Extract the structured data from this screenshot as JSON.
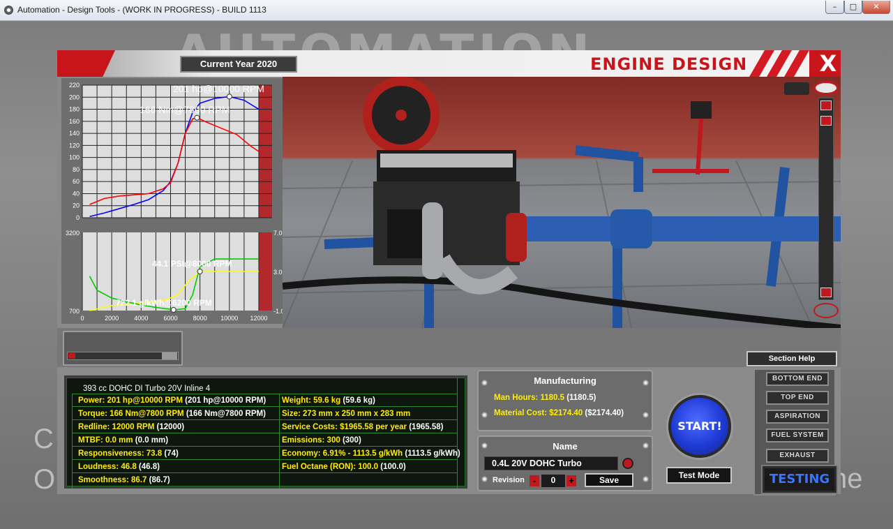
{
  "window": {
    "title": "Automation - Design Tools - (WORK IN PROGRESS) - BUILD 1113",
    "minimize": "–",
    "maximize": "□",
    "close": "✕"
  },
  "background": {
    "logo": "AUTOMATION",
    "left_text_1": "C",
    "left_text_2": "O",
    "right_text": "ne"
  },
  "header": {
    "current_year": "Current Year 2020",
    "title": "ENGINE DESIGN",
    "close": "X"
  },
  "chart_data": [
    {
      "type": "line",
      "title": "",
      "xlim": [
        0,
        12000
      ],
      "ylim": [
        0,
        220
      ],
      "yticks": [
        0,
        20,
        40,
        60,
        80,
        100,
        120,
        140,
        160,
        180,
        200,
        220
      ],
      "redline": 12000,
      "series": [
        {
          "color": "#0000ff",
          "x": [
            500,
            1500,
            2500,
            3500,
            4500,
            5500,
            6000,
            6500,
            7000,
            7500,
            8000,
            9000,
            10000,
            11000,
            12000
          ],
          "values": [
            2,
            8,
            15,
            22,
            30,
            45,
            60,
            90,
            140,
            175,
            190,
            198,
            201,
            195,
            180
          ]
        },
        {
          "color": "#ff0000",
          "x": [
            500,
            1500,
            2500,
            3500,
            4500,
            5500,
            6000,
            6500,
            7000,
            7500,
            7800,
            8500,
            9500,
            10500,
            11500,
            12000
          ],
          "values": [
            22,
            32,
            36,
            38,
            40,
            48,
            58,
            90,
            140,
            164,
            166,
            158,
            148,
            138,
            118,
            110
          ]
        }
      ],
      "annotations": [
        {
          "text": "201 hp@10000 RPM",
          "x": 10000,
          "y": 201
        },
        {
          "text": "166 Nm@7800 RPM",
          "x": 7800,
          "y": 166
        }
      ]
    },
    {
      "type": "line",
      "xlim": [
        0,
        12000
      ],
      "x_ticks": [
        0,
        2000,
        4000,
        6000,
        8000,
        10000,
        12000
      ],
      "left_ylim": [
        700,
        3200
      ],
      "left_ticks": [
        700,
        3200
      ],
      "right_ylim": [
        -1.0,
        7.0
      ],
      "right_ticks": [
        "7.0",
        "3.0",
        "-1.0"
      ],
      "redline": 12000,
      "series": [
        {
          "color": "#ffff00",
          "axis": "right",
          "x": [
            500,
            2000,
            4000,
            5500,
            6500,
            7200,
            8000,
            9000,
            12000
          ],
          "values": [
            -1.0,
            -0.5,
            -0.2,
            0.0,
            0.6,
            2.0,
            3.0,
            3.0,
            3.0
          ]
        },
        {
          "color": "#00cc00",
          "axis": "left",
          "x": [
            500,
            1000,
            2000,
            3000,
            4000,
            5000,
            6000,
            6200,
            7000,
            7500,
            8000,
            9000,
            10000,
            12000
          ],
          "values": [
            1800,
            1350,
            1100,
            980,
            880,
            800,
            740,
            722,
            760,
            1200,
            2100,
            2350,
            2350,
            2350
          ]
        }
      ],
      "annotations": [
        {
          "text": "44.1 PSI@8000 RPM",
          "x": 8000,
          "y": 3.0
        },
        {
          "text": "722.1 g/kWh@6200 RPM",
          "x": 6200,
          "y": 722
        }
      ]
    }
  ],
  "stats": {
    "engine_desc": "393 cc DOHC DI Turbo 20V Inline 4",
    "left": [
      {
        "label": "Power: 201 hp@10000 RPM",
        "value": "(201 hp@10000 RPM)"
      },
      {
        "label": "Torque: 166 Nm@7800 RPM",
        "value": "(166 Nm@7800 RPM)"
      },
      {
        "label": "Redline: 12000 RPM",
        "value": "(12000)"
      },
      {
        "label": "MTBF: 0.0 mm",
        "value": "(0.0 mm)"
      },
      {
        "label": "Responsiveness: 73.8",
        "value": "(74)"
      },
      {
        "label": "Loudness: 46.8",
        "value": "(46.8)"
      },
      {
        "label": "Smoothness: 86.7",
        "value": "(86.7)"
      }
    ],
    "right": [
      {
        "label": "Weight: 59.6 kg",
        "value": "(59.6 kg)"
      },
      {
        "label": "Size: 273 mm x 250 mm x 283 mm",
        "value": ""
      },
      {
        "label": "Service Costs: $1965.58 per year",
        "value": "(1965.58)"
      },
      {
        "label": "Emissions: 300",
        "value": "(300)"
      },
      {
        "label": "Economy: 6.91% - 1113.5 g/kWh",
        "value": "(1113.5 g/kWh)"
      },
      {
        "label": "Fuel Octane (RON): 100.0",
        "value": "(100.0)"
      }
    ]
  },
  "manufacturing": {
    "title": "Manufacturing",
    "man_hours_label": "Man Hours: 1180.5",
    "man_hours_value": "(1180.5)",
    "material_cost_label": "Material Cost: $2174.40",
    "material_cost_value": "($2174.40)"
  },
  "name_panel": {
    "title": "Name",
    "name_value": "0.4L 20V DOHC Turbo",
    "revision_label": "Revision",
    "revision_minus": "-",
    "revision_value": "0",
    "revision_plus": "+",
    "save_label": "Save"
  },
  "actions": {
    "start_label": "START!",
    "test_mode_label": "Test Mode"
  },
  "sections": {
    "help_label": "Section Help",
    "items": [
      "BOTTOM END",
      "TOP END",
      "ASPIRATION",
      "FUEL SYSTEM",
      "EXHAUST"
    ],
    "testing_label": "TESTING"
  }
}
